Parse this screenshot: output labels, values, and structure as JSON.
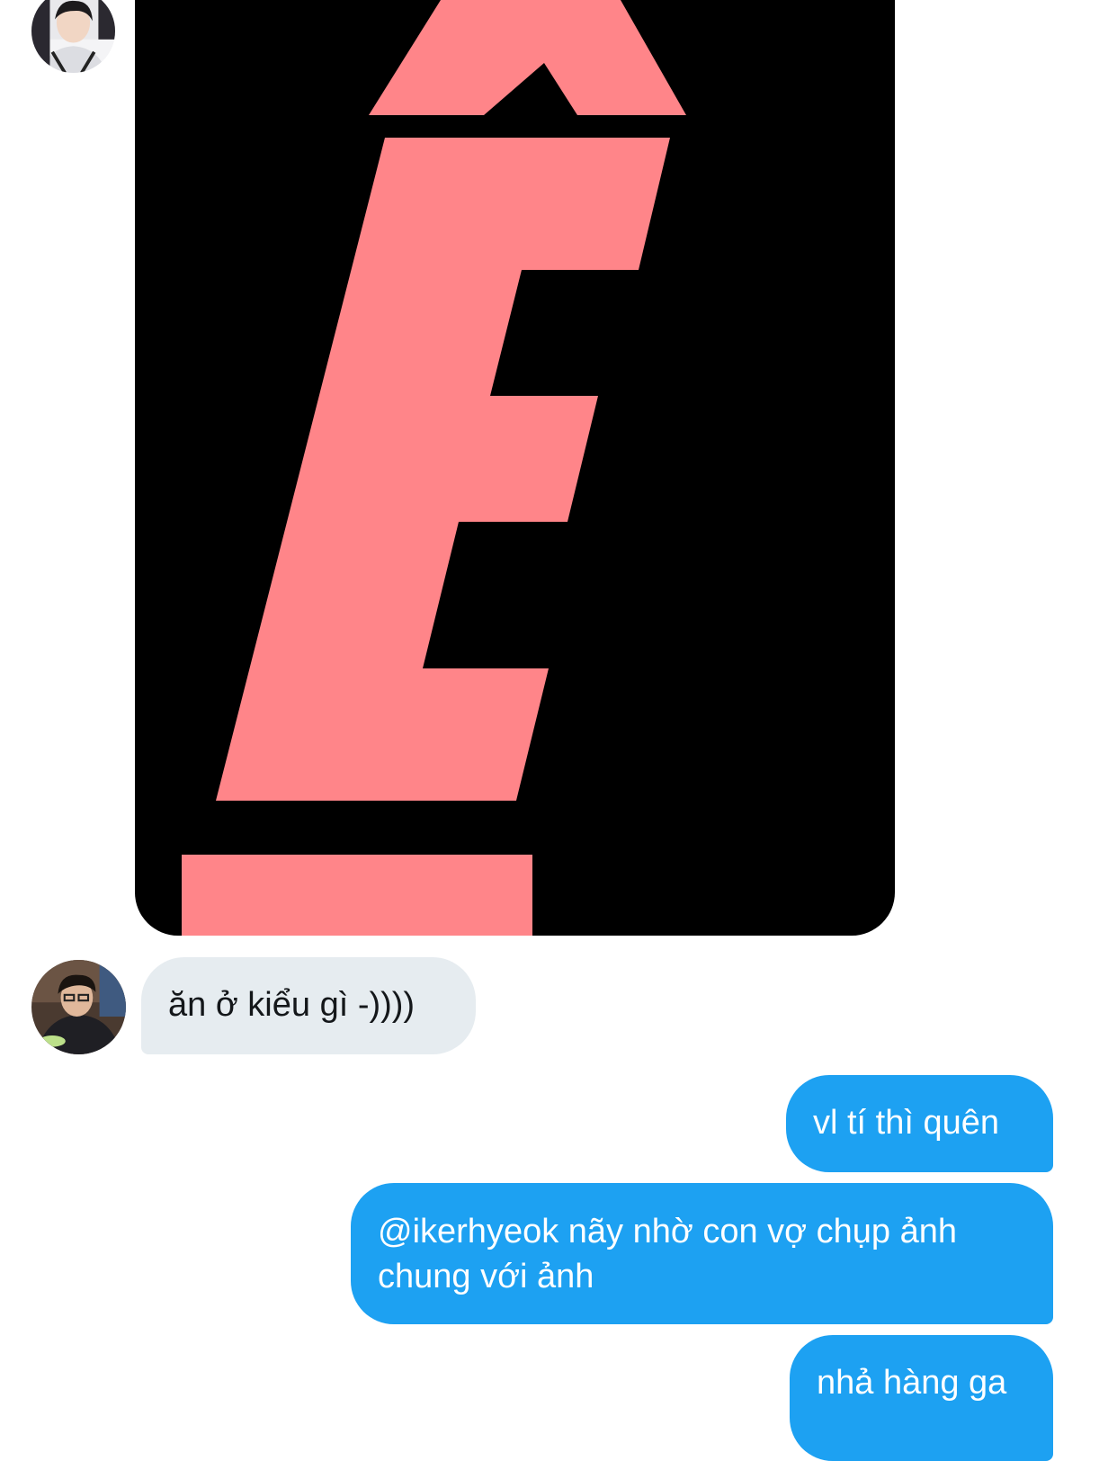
{
  "conversation": {
    "colors": {
      "sent_bubble": "#1da1f2",
      "received_bubble": "#e6ecf0",
      "image_background": "#000000",
      "image_letter": "#ff8589"
    },
    "image_message": {
      "letter": "Ê"
    },
    "messages": [
      {
        "direction": "received",
        "text": "ăn ở kiểu gì -))))"
      },
      {
        "direction": "sent",
        "text": "vl tí thì quên"
      },
      {
        "direction": "sent",
        "text": "@ikerhyeok nãy nhờ con vợ chụp ảnh chung với ảnh"
      },
      {
        "direction": "sent",
        "text": "nhả hàng ga"
      }
    ]
  }
}
